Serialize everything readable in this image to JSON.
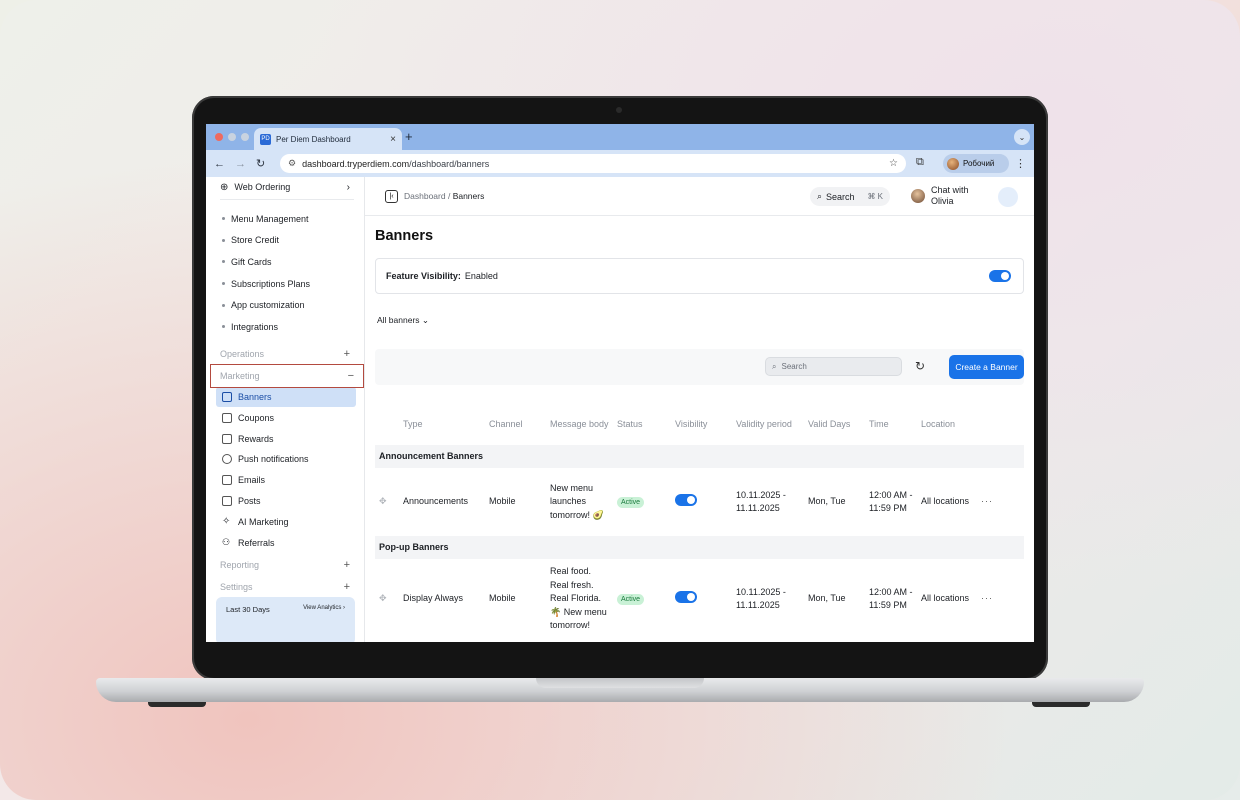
{
  "browser": {
    "tab_title": "Per Diem Dashboard",
    "url_host": "dashboard.tryperdiem.com",
    "url_path": "/dashboard/banners",
    "profile_name": "Робочий",
    "favicon_text": "PD"
  },
  "sidebar": {
    "top_item": "Web Ordering",
    "sub_items": [
      "Menu Management",
      "Store Credit",
      "Gift Cards",
      "Subscriptions Plans",
      "App customization",
      "Integrations"
    ],
    "sections": {
      "operations": "Operations",
      "marketing": "Marketing",
      "reporting": "Reporting",
      "settings": "Settings"
    },
    "marketing_items": [
      "Banners",
      "Coupons",
      "Rewards",
      "Push notifications",
      "Emails",
      "Posts",
      "AI Marketing",
      "Referrals"
    ],
    "card": {
      "period": "Last 30 Days",
      "link": "View Analytics"
    }
  },
  "header": {
    "breadcrumb_root": "Dashboard",
    "breadcrumb_current": "Banners",
    "search_label": "Search",
    "search_shortcut": "⌘ K",
    "chat_line1": "Chat with",
    "chat_line2": "Olivia"
  },
  "main": {
    "title": "Banners",
    "feature_label": "Feature Visibility:",
    "feature_value": "Enabled",
    "filter_label": "All banners",
    "search_placeholder": "Search",
    "create_button": "Create a Banner",
    "columns": [
      "Type",
      "Channel",
      "Message body",
      "Status",
      "Visibility",
      "Validity period",
      "Valid Days",
      "Time",
      "Location"
    ],
    "groups": [
      {
        "name": "Announcement Banners",
        "rows": [
          {
            "type": "Announcements",
            "channel": "Mobile",
            "message": "New menu launches tomorrow! 🥑",
            "status": "Active",
            "visibility": true,
            "validity": "10.11.2025 - 11.11.2025",
            "days": "Mon, Tue",
            "time": "12:00 AM - 11:59 PM",
            "location": "All locations"
          }
        ]
      },
      {
        "name": "Pop-up Banners",
        "rows": [
          {
            "type": "Display Always",
            "channel": "Mobile",
            "message": "Real food. Real fresh. Real Florida. 🌴 New menu tomorrow!",
            "status": "Active",
            "visibility": true,
            "validity": "10.11.2025 - 11.11.2025",
            "days": "Mon, Tue",
            "time": "12:00 AM - 11:59 PM",
            "location": "All locations"
          }
        ]
      }
    ]
  },
  "colors": {
    "accent": "#1a73e8",
    "active_nav_bg": "#cfe0f7",
    "badge_bg": "#c9f1d6",
    "selection_outline": "#b34a3f"
  }
}
